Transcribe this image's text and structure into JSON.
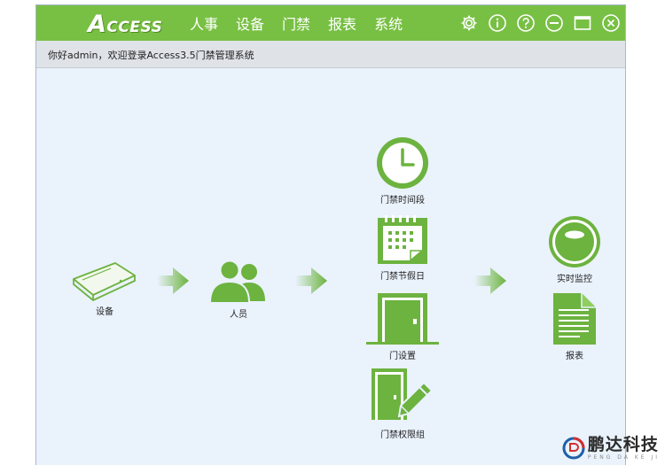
{
  "app": {
    "logo_initial": "A",
    "logo_rest": "CCESS",
    "menu": [
      "人事",
      "设备",
      "门禁",
      "报表",
      "系统"
    ],
    "titlebar_icons": [
      "gear-icon",
      "info-icon",
      "help-icon",
      "minimize-icon",
      "maximize-icon",
      "close-icon"
    ]
  },
  "greeting": {
    "text": "你好admin，欢迎登录Access3.5门禁管理系统"
  },
  "workflow": {
    "device": "设备",
    "personnel": "人员",
    "time_zone": "门禁时间段",
    "holiday": "门禁节假日",
    "door_settings": "门设置",
    "access_level": "门禁权限组",
    "realtime_monitor": "实时监控",
    "reports": "报表"
  },
  "watermark": {
    "title": "鹏达科技",
    "subtitle": "PENG DA KE JI"
  },
  "colors": {
    "brand_green": "#78c044",
    "icon_green": "#6cb33f",
    "background": "#eaf2fc"
  }
}
